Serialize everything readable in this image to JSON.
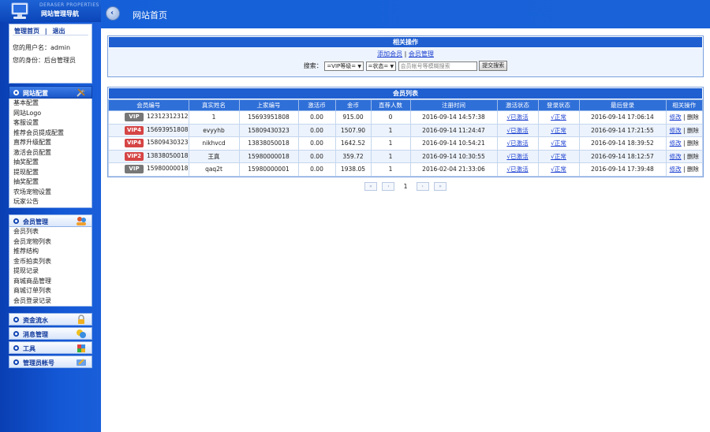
{
  "logo": {
    "en": "DERASER PROPERTIES",
    "cn": "网站管理导航"
  },
  "user": {
    "home_link": "管理首页",
    "sep": "|",
    "logout_link": "退出",
    "username_line": "您的用户名：admin",
    "role_line": "您的身份：后台管理员"
  },
  "menus": [
    {
      "title": "网站配置",
      "icon": "tools-icon",
      "active": true,
      "items": [
        "基本配置",
        "网站Logo",
        "客服设置",
        "推荐会员提成配置",
        "直荐升级配置",
        "激活会员配置",
        "抽奖配置",
        "提现配置",
        "抽奖配置",
        "农场宠物设置",
        "玩家公告"
      ]
    },
    {
      "title": "会员管理",
      "icon": "users-icon",
      "active": false,
      "items": [
        "会员列表",
        "会员宠物列表",
        "推荐结构",
        "金币拍卖列表",
        "提现记录",
        "商城商品管理",
        "商城订单列表",
        "会员登录记录"
      ]
    },
    {
      "title": "资金流水",
      "icon": "lock-icon",
      "active": false,
      "items": []
    },
    {
      "title": "消息管理",
      "icon": "message-icon",
      "active": false,
      "items": []
    },
    {
      "title": "工具",
      "icon": "puzzle-icon",
      "active": false,
      "items": []
    },
    {
      "title": "管理员帐号",
      "icon": "admin-icon",
      "active": false,
      "items": []
    }
  ],
  "topbar": {
    "title": "网站首页"
  },
  "ops": {
    "title": "相关操作",
    "add_link": "添加会员",
    "sep": "|",
    "manage_link": "会员管理",
    "search_label": "搜索：",
    "vip_select": "=VIP等级=",
    "status_select": "=状态=",
    "search_placeholder": "会员帐号等模糊搜索",
    "search_button": "提交搜索"
  },
  "list": {
    "title": "会员列表",
    "columns": [
      "会员编号",
      "真实姓名",
      "上家编号",
      "激活币",
      "金币",
      "直荐人数",
      "注册时间",
      "激活状态",
      "登录状态",
      "最后登录",
      "相关操作"
    ],
    "rows": [
      {
        "vip": "VIP",
        "vip_color": "#777777",
        "id": "12312312312",
        "name": "1",
        "parent": "15693951808",
        "act_coin": "0.00",
        "gold": "915.00",
        "direct": "0",
        "reg": "2016-09-14 14:57:38",
        "act": "√已激活",
        "login": "√正常",
        "last": "2016-09-14 17:06:14",
        "edit": "修改",
        "del": "删除"
      },
      {
        "vip": "VIP4",
        "vip_color": "#d64545",
        "id": "15693951808",
        "name": "evyyhb",
        "parent": "15809430323",
        "act_coin": "0.00",
        "gold": "1507.90",
        "direct": "1",
        "reg": "2016-09-14 11:24:47",
        "act": "√已激活",
        "login": "√正常",
        "last": "2016-09-14 17:21:55",
        "edit": "修改",
        "del": "删除"
      },
      {
        "vip": "VIP4",
        "vip_color": "#d64545",
        "id": "15809430323",
        "name": "nikhvcd",
        "parent": "13838050018",
        "act_coin": "0.00",
        "gold": "1642.52",
        "direct": "1",
        "reg": "2016-09-14 10:54:21",
        "act": "√已激活",
        "login": "√正常",
        "last": "2016-09-14 18:39:52",
        "edit": "修改",
        "del": "删除"
      },
      {
        "vip": "VIP2",
        "vip_color": "#d64545",
        "id": "13838050018",
        "name": "王真",
        "parent": "15980000018",
        "act_coin": "0.00",
        "gold": "359.72",
        "direct": "1",
        "reg": "2016-09-14 10:30:55",
        "act": "√已激活",
        "login": "√正常",
        "last": "2016-09-14 18:12:57",
        "edit": "修改",
        "del": "删除"
      },
      {
        "vip": "VIP",
        "vip_color": "#777777",
        "id": "15980000018",
        "name": "qaq2t",
        "parent": "15980000001",
        "act_coin": "0.00",
        "gold": "1938.05",
        "direct": "1",
        "reg": "2016-02-04 21:33:06",
        "act": "√已激活",
        "login": "√正常",
        "last": "2016-09-14 17:39:48",
        "edit": "修改",
        "del": "删除"
      }
    ]
  },
  "pager": {
    "first": "«",
    "prev": "‹",
    "current": "1",
    "next": "›",
    "last": "»"
  }
}
